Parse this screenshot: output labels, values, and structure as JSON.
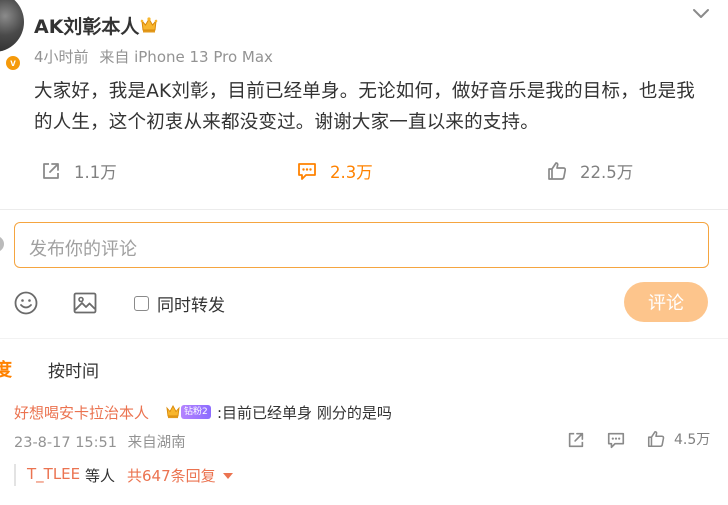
{
  "post": {
    "username": "AK刘彰本人",
    "time": "4小时前",
    "source": "来自 iPhone 13 Pro Max",
    "verified_badge": "v",
    "content": "大家好，我是AK刘彰，目前已经单身。无论如何，做好音乐是我的目标，也是我的人生，这个初衷从来都没变过。谢谢大家一直以来的支持。",
    "actions": {
      "share_count": "1.1万",
      "comment_count": "2.3万",
      "like_count": "22.5万"
    }
  },
  "composer": {
    "placeholder": "发布你的评论",
    "repost_label": "同时转发",
    "submit_label": "评论"
  },
  "sort": {
    "hot_label": "度",
    "time_label": "按时间"
  },
  "comment": {
    "username": "好想喝安卡拉治本人",
    "tag": "钻粉2",
    "text": ":目前已经单身 刚分的是吗",
    "date": "23-8-17 15:51",
    "location": "来自湖南",
    "like_count": "4.5万",
    "reply_user": "T_TLEE",
    "reply_mid": "等人",
    "reply_total": "共647条回复"
  },
  "colors": {
    "accent": "#ff8200",
    "link": "#eb7350",
    "muted": "#939393",
    "button_disabled": "#fdc58c"
  }
}
